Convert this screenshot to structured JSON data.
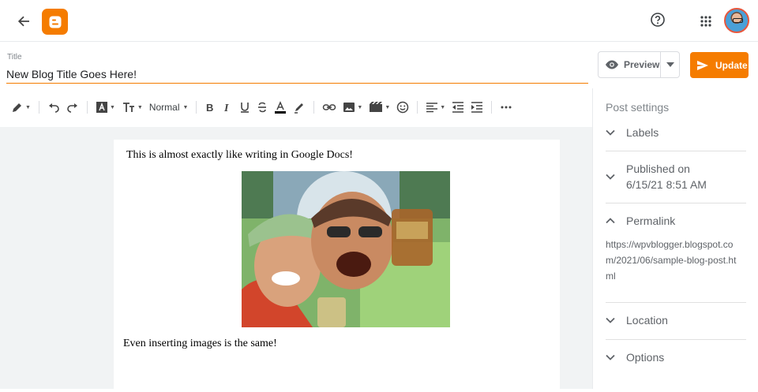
{
  "editor": {
    "title_label": "Title",
    "title_value": "New Blog Title Goes Here!",
    "preview_label": "Preview",
    "update_label": "Update",
    "font_size": "Normal"
  },
  "content": {
    "paragraph1": "This is almost exactly like writing in Google Docs!",
    "paragraph2": "Even inserting images is the same!"
  },
  "sidebar": {
    "title": "Post settings",
    "labels": "Labels",
    "published_label": "Published on",
    "published_date": "6/15/21 8:51 AM",
    "permalink": "Permalink",
    "permalink_url": "https://wpvblogger.blogspot.com/2021/06/sample-blog-post.html",
    "location": "Location",
    "options": "Options"
  },
  "colors": {
    "accent": "#f57c00"
  },
  "icons": [
    "back-arrow-icon",
    "blogger-logo-icon",
    "help-icon",
    "apps-grid-icon",
    "eye-icon",
    "send-icon"
  ]
}
